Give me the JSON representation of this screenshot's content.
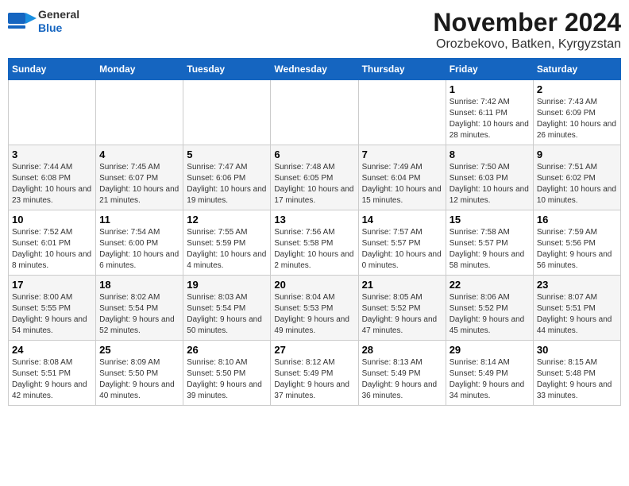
{
  "header": {
    "logo_general": "General",
    "logo_blue": "Blue",
    "month_title": "November 2024",
    "location": "Orozbekovo, Batken, Kyrgyzstan"
  },
  "weekdays": [
    "Sunday",
    "Monday",
    "Tuesday",
    "Wednesday",
    "Thursday",
    "Friday",
    "Saturday"
  ],
  "weeks": [
    [
      {
        "day": "",
        "info": ""
      },
      {
        "day": "",
        "info": ""
      },
      {
        "day": "",
        "info": ""
      },
      {
        "day": "",
        "info": ""
      },
      {
        "day": "",
        "info": ""
      },
      {
        "day": "1",
        "info": "Sunrise: 7:42 AM\nSunset: 6:11 PM\nDaylight: 10 hours and 28 minutes."
      },
      {
        "day": "2",
        "info": "Sunrise: 7:43 AM\nSunset: 6:09 PM\nDaylight: 10 hours and 26 minutes."
      }
    ],
    [
      {
        "day": "3",
        "info": "Sunrise: 7:44 AM\nSunset: 6:08 PM\nDaylight: 10 hours and 23 minutes."
      },
      {
        "day": "4",
        "info": "Sunrise: 7:45 AM\nSunset: 6:07 PM\nDaylight: 10 hours and 21 minutes."
      },
      {
        "day": "5",
        "info": "Sunrise: 7:47 AM\nSunset: 6:06 PM\nDaylight: 10 hours and 19 minutes."
      },
      {
        "day": "6",
        "info": "Sunrise: 7:48 AM\nSunset: 6:05 PM\nDaylight: 10 hours and 17 minutes."
      },
      {
        "day": "7",
        "info": "Sunrise: 7:49 AM\nSunset: 6:04 PM\nDaylight: 10 hours and 15 minutes."
      },
      {
        "day": "8",
        "info": "Sunrise: 7:50 AM\nSunset: 6:03 PM\nDaylight: 10 hours and 12 minutes."
      },
      {
        "day": "9",
        "info": "Sunrise: 7:51 AM\nSunset: 6:02 PM\nDaylight: 10 hours and 10 minutes."
      }
    ],
    [
      {
        "day": "10",
        "info": "Sunrise: 7:52 AM\nSunset: 6:01 PM\nDaylight: 10 hours and 8 minutes."
      },
      {
        "day": "11",
        "info": "Sunrise: 7:54 AM\nSunset: 6:00 PM\nDaylight: 10 hours and 6 minutes."
      },
      {
        "day": "12",
        "info": "Sunrise: 7:55 AM\nSunset: 5:59 PM\nDaylight: 10 hours and 4 minutes."
      },
      {
        "day": "13",
        "info": "Sunrise: 7:56 AM\nSunset: 5:58 PM\nDaylight: 10 hours and 2 minutes."
      },
      {
        "day": "14",
        "info": "Sunrise: 7:57 AM\nSunset: 5:57 PM\nDaylight: 10 hours and 0 minutes."
      },
      {
        "day": "15",
        "info": "Sunrise: 7:58 AM\nSunset: 5:57 PM\nDaylight: 9 hours and 58 minutes."
      },
      {
        "day": "16",
        "info": "Sunrise: 7:59 AM\nSunset: 5:56 PM\nDaylight: 9 hours and 56 minutes."
      }
    ],
    [
      {
        "day": "17",
        "info": "Sunrise: 8:00 AM\nSunset: 5:55 PM\nDaylight: 9 hours and 54 minutes."
      },
      {
        "day": "18",
        "info": "Sunrise: 8:02 AM\nSunset: 5:54 PM\nDaylight: 9 hours and 52 minutes."
      },
      {
        "day": "19",
        "info": "Sunrise: 8:03 AM\nSunset: 5:54 PM\nDaylight: 9 hours and 50 minutes."
      },
      {
        "day": "20",
        "info": "Sunrise: 8:04 AM\nSunset: 5:53 PM\nDaylight: 9 hours and 49 minutes."
      },
      {
        "day": "21",
        "info": "Sunrise: 8:05 AM\nSunset: 5:52 PM\nDaylight: 9 hours and 47 minutes."
      },
      {
        "day": "22",
        "info": "Sunrise: 8:06 AM\nSunset: 5:52 PM\nDaylight: 9 hours and 45 minutes."
      },
      {
        "day": "23",
        "info": "Sunrise: 8:07 AM\nSunset: 5:51 PM\nDaylight: 9 hours and 44 minutes."
      }
    ],
    [
      {
        "day": "24",
        "info": "Sunrise: 8:08 AM\nSunset: 5:51 PM\nDaylight: 9 hours and 42 minutes."
      },
      {
        "day": "25",
        "info": "Sunrise: 8:09 AM\nSunset: 5:50 PM\nDaylight: 9 hours and 40 minutes."
      },
      {
        "day": "26",
        "info": "Sunrise: 8:10 AM\nSunset: 5:50 PM\nDaylight: 9 hours and 39 minutes."
      },
      {
        "day": "27",
        "info": "Sunrise: 8:12 AM\nSunset: 5:49 PM\nDaylight: 9 hours and 37 minutes."
      },
      {
        "day": "28",
        "info": "Sunrise: 8:13 AM\nSunset: 5:49 PM\nDaylight: 9 hours and 36 minutes."
      },
      {
        "day": "29",
        "info": "Sunrise: 8:14 AM\nSunset: 5:49 PM\nDaylight: 9 hours and 34 minutes."
      },
      {
        "day": "30",
        "info": "Sunrise: 8:15 AM\nSunset: 5:48 PM\nDaylight: 9 hours and 33 minutes."
      }
    ]
  ]
}
